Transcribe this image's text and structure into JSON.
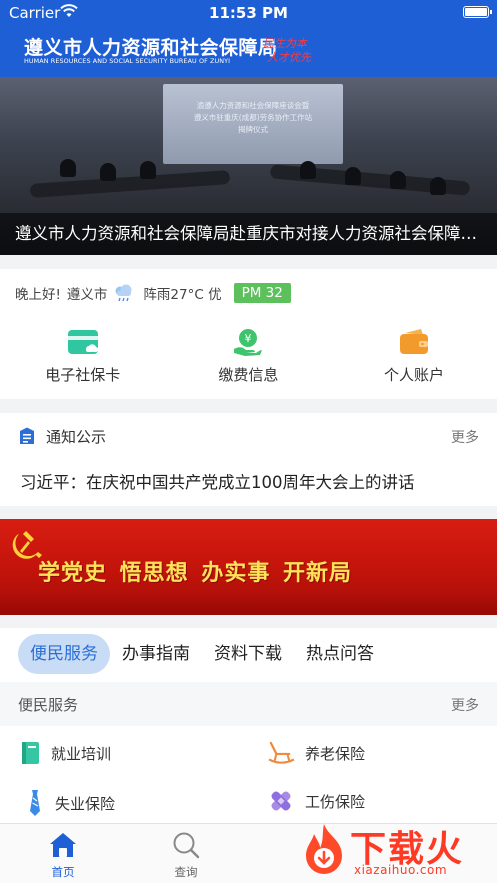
{
  "status_bar": {
    "carrier": "Carrier",
    "time": "11:53 PM"
  },
  "header": {
    "title": "遵义市人力资源和社会保障局",
    "subtitle": "HUMAN RESOURCES AND SOCIAL SECURITY BUREAU OF ZUNYI",
    "slogan_line1": "民生为本",
    "slogan_line2": "人才优先",
    "slogan_color": "#ff3b3b",
    "brand_color": "#1f5fd6"
  },
  "banner": {
    "screen_text_1": "渝遵人力资源和社会保障座谈会暨",
    "screen_text_2": "遵义市驻重庆(成都)劳务协作工作站",
    "screen_text_3": "揭牌仪式",
    "caption": "遵义市人力资源和社会保障局赴重庆市对接人力资源社会保障…"
  },
  "weather": {
    "greeting": "晚上好!",
    "city": "遵义市",
    "icon": "rain-cloud-icon",
    "condition": "阵雨27°C 优",
    "pm_label": "PM 32",
    "pm_color": "#5cc05c"
  },
  "quick_links": [
    {
      "label": "电子社保卡",
      "icon": "social-security-card-icon"
    },
    {
      "label": "缴费信息",
      "icon": "payment-info-icon"
    },
    {
      "label": "个人账户",
      "icon": "wallet-icon"
    }
  ],
  "notice": {
    "title": "通知公示",
    "more": "更多",
    "item": "习近平：在庆祝中国共产党成立100周年大会上的讲话"
  },
  "party_banner": {
    "slogan": "学党史 悟思想 办实事 开新局"
  },
  "tabs": [
    {
      "label": "便民服务",
      "active": true
    },
    {
      "label": "办事指南",
      "active": false
    },
    {
      "label": "资料下载",
      "active": false
    },
    {
      "label": "热点问答",
      "active": false
    }
  ],
  "service_section": {
    "title": "便民服务",
    "more": "更多",
    "items": [
      {
        "label": "就业培训",
        "icon": "book-icon"
      },
      {
        "label": "养老保险",
        "icon": "rocking-chair-icon"
      },
      {
        "label": "失业保险",
        "icon": "tie-icon"
      },
      {
        "label": "工伤保险",
        "icon": "bandage-icon"
      }
    ]
  },
  "tab_bar": {
    "home": "首页",
    "query": "查询"
  },
  "watermark": {
    "main": "下载火",
    "sub": "xiazaihuo.com"
  }
}
